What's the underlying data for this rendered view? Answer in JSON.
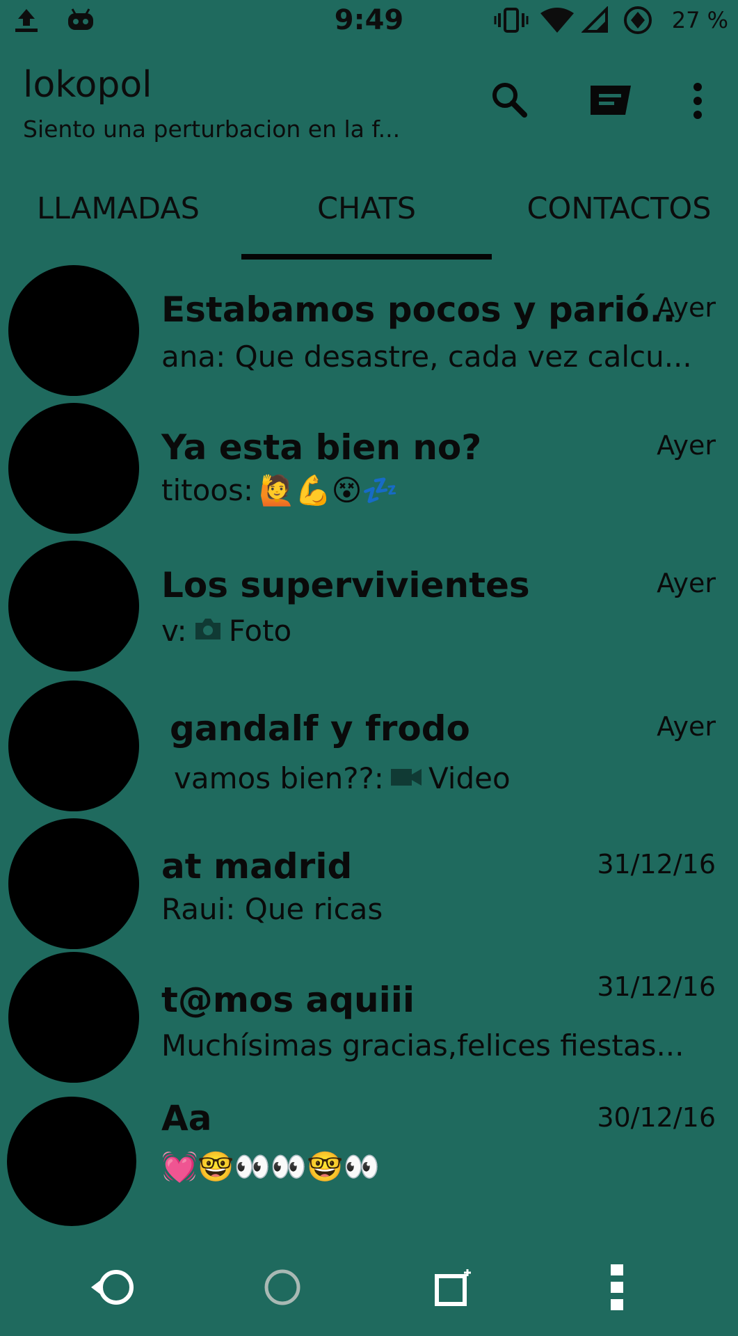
{
  "status_bar": {
    "time": "9:49",
    "battery": "27 %",
    "icons": [
      "upload-icon",
      "android-icon",
      "vibrate-icon",
      "wifi-icon",
      "signal-icon",
      "data-saver-icon"
    ]
  },
  "app_bar": {
    "title": "lokopol",
    "subtitle": "Siento una perturbacion en la f...",
    "actions": [
      "search-icon",
      "new-chat-icon",
      "more-options-icon"
    ]
  },
  "tabs": [
    {
      "label": "LLAMADAS",
      "selected": false
    },
    {
      "label": "CHATS",
      "selected": true
    },
    {
      "label": "CONTACTOS",
      "selected": false
    }
  ],
  "chats": [
    {
      "title": "Estabamos pocos y parió..",
      "time": "Ayer",
      "preview": "ana: Que desastre, cada vez calcu..."
    },
    {
      "title": "Ya esta bien no?",
      "time": "Ayer",
      "preview": "titoos:",
      "emoji": "🙋💪😵💤"
    },
    {
      "title": "Los supervivientes",
      "time": "Ayer",
      "preview": "v:",
      "media": "Foto"
    },
    {
      "title": "gandalf y frodo",
      "time": "Ayer",
      "preview": "vamos bien??:",
      "media": "Video"
    },
    {
      "title": "at madrid",
      "time": "31/12/16",
      "preview": "Raui: Que ricas"
    },
    {
      "title": "t@mos aquiii",
      "time": "31/12/16",
      "preview": "Muchísimas gracias,felices fiestas..."
    },
    {
      "title": "Aa",
      "time": "30/12/16",
      "preview": "",
      "emoji": "💓🤓👀👀🤓👀"
    }
  ],
  "nav_bar": [
    "back-icon",
    "home-icon",
    "recents-icon",
    "menu-icon"
  ],
  "colors": {
    "background": "#1f6a5e",
    "text": "#0a0a0a",
    "indicator": "#050505"
  }
}
